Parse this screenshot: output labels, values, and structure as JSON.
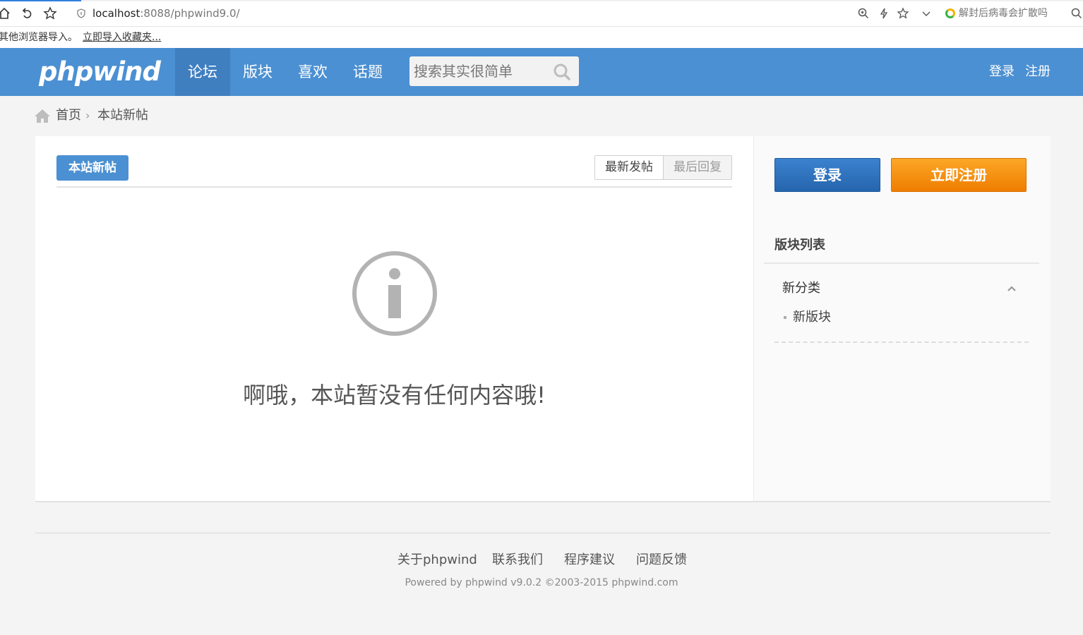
{
  "browser": {
    "url_host": "localhost",
    "url_rest": ":8088/phpwind9.0/",
    "extension_text": "解封后病毒会扩散吗"
  },
  "bookmark_bar": {
    "text": "其他浏览器导入。",
    "import_link": "立即导入收藏夹..."
  },
  "header": {
    "logo": "phpwind",
    "nav": [
      {
        "label": "论坛"
      },
      {
        "label": "版块"
      },
      {
        "label": "喜欢"
      },
      {
        "label": "话题"
      }
    ],
    "search_placeholder": "搜索其实很简单",
    "login": "登录",
    "register": "注册",
    "brand_color": "#4b90d2"
  },
  "breadcrumb": {
    "home": "首页",
    "current": "本站新帖"
  },
  "main": {
    "tag": "本站新帖",
    "sort_latest_post": "最新发帖",
    "sort_last_reply": "最后回复",
    "empty_message": "啊哦，本站暂没有任何内容哦!"
  },
  "sidebar": {
    "login_button": "登录",
    "register_button": "立即注册",
    "section_title": "版块列表",
    "category": "新分类",
    "board": "新版块"
  },
  "footer": {
    "links": [
      "关于phpwind",
      "联系我们",
      "程序建议",
      "问题反馈"
    ],
    "powered": "Powered by phpwind v9.0.2 ©2003-2015 phpwind.com"
  }
}
